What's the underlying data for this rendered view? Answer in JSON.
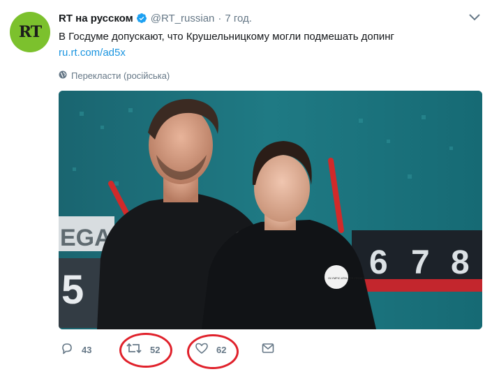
{
  "tweet": {
    "avatar_text": "RT",
    "name": "RT на русском",
    "handle": "@RT_russian",
    "separator": "·",
    "time": "7 год.",
    "text": "В Госдуме допускают, что Крушельницкому могли подмешать допинг",
    "link": "ru.rt.com/ad5x",
    "translate": "Перекласти (російська)"
  },
  "media": {
    "badge_text": "OLYMPIC ATHLETE FROM RUSSIA",
    "scoreboard_digits": [
      "6",
      "7",
      "8"
    ],
    "left_board_text": "EGA",
    "left_board_number": "5"
  },
  "actions": {
    "reply_count": "43",
    "retweet_count": "52",
    "like_count": "62"
  },
  "colors": {
    "accent": "#1b95e0",
    "secondary_text": "#657786",
    "avatar_bg": "#7cc12d",
    "annotation": "#e0212b"
  },
  "icons": [
    "verified-icon",
    "chevron-down-icon",
    "globe-icon",
    "reply-icon",
    "retweet-icon",
    "like-icon",
    "message-icon"
  ]
}
